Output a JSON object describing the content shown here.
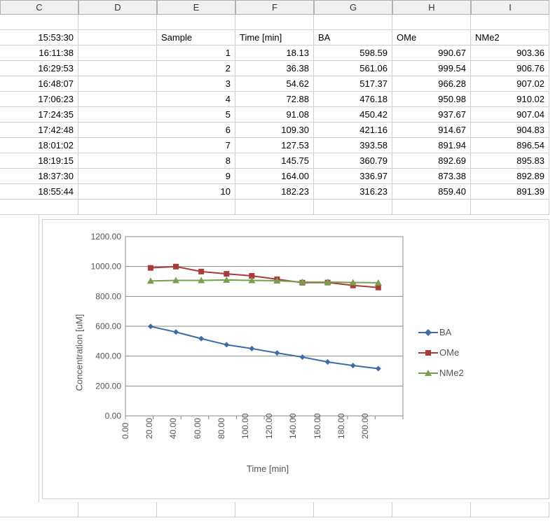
{
  "columns": [
    "C",
    "D",
    "E",
    "F",
    "G",
    "H",
    "I"
  ],
  "header_row": {
    "C": "15:53:30",
    "D": "",
    "E": "Sample",
    "F": "Time [min]",
    "G": "BA",
    "H": "OMe",
    "I": "NMe2"
  },
  "rows": [
    {
      "C": "16:11:38",
      "E": "1",
      "F": "18.13",
      "G": "598.59",
      "H": "990.67",
      "I": "903.36"
    },
    {
      "C": "16:29:53",
      "E": "2",
      "F": "36.38",
      "G": "561.06",
      "H": "999.54",
      "I": "906.76"
    },
    {
      "C": "16:48:07",
      "E": "3",
      "F": "54.62",
      "G": "517.37",
      "H": "966.28",
      "I": "907.02"
    },
    {
      "C": "17:06:23",
      "E": "4",
      "F": "72.88",
      "G": "476.18",
      "H": "950.98",
      "I": "910.02"
    },
    {
      "C": "17:24:35",
      "E": "5",
      "F": "91.08",
      "G": "450.42",
      "H": "937.67",
      "I": "907.04"
    },
    {
      "C": "17:42:48",
      "E": "6",
      "F": "109.30",
      "G": "421.16",
      "H": "914.67",
      "I": "904.83"
    },
    {
      "C": "18:01:02",
      "E": "7",
      "F": "127.53",
      "G": "393.58",
      "H": "891.94",
      "I": "896.54"
    },
    {
      "C": "18:19:15",
      "E": "8",
      "F": "145.75",
      "G": "360.79",
      "H": "892.69",
      "I": "895.83"
    },
    {
      "C": "18:37:30",
      "E": "9",
      "F": "164.00",
      "G": "336.97",
      "H": "873.38",
      "I": "892.89"
    },
    {
      "C": "18:55:44",
      "E": "10",
      "F": "182.23",
      "G": "316.23",
      "H": "859.40",
      "I": "891.39"
    }
  ],
  "chart_data": {
    "type": "line",
    "title": "",
    "xlabel": "Time [min]",
    "ylabel": "Concentration [uM]",
    "xlim": [
      0,
      200
    ],
    "ylim": [
      0,
      1200
    ],
    "xticks": [
      "0.00",
      "20.00",
      "40.00",
      "60.00",
      "80.00",
      "100.00",
      "120.00",
      "140.00",
      "160.00",
      "180.00",
      "200.00"
    ],
    "yticks": [
      "0.00",
      "200.00",
      "400.00",
      "600.00",
      "800.00",
      "1000.00",
      "1200.00"
    ],
    "x": [
      18.13,
      36.38,
      54.62,
      72.88,
      91.08,
      109.3,
      127.53,
      145.75,
      164.0,
      182.23
    ],
    "series": [
      {
        "name": "BA",
        "color": "#3f6ca8",
        "marker": "diamond",
        "values": [
          598.59,
          561.06,
          517.37,
          476.18,
          450.42,
          421.16,
          393.58,
          360.79,
          336.97,
          316.23
        ]
      },
      {
        "name": "OMe",
        "color": "#a83c3c",
        "marker": "square",
        "values": [
          990.67,
          999.54,
          966.28,
          950.98,
          937.67,
          914.67,
          891.94,
          892.69,
          873.38,
          859.4
        ]
      },
      {
        "name": "NMe2",
        "color": "#7a9e4e",
        "marker": "triangle",
        "values": [
          903.36,
          906.76,
          907.02,
          910.02,
          907.04,
          904.83,
          896.54,
          895.83,
          892.89,
          891.39
        ]
      }
    ]
  }
}
